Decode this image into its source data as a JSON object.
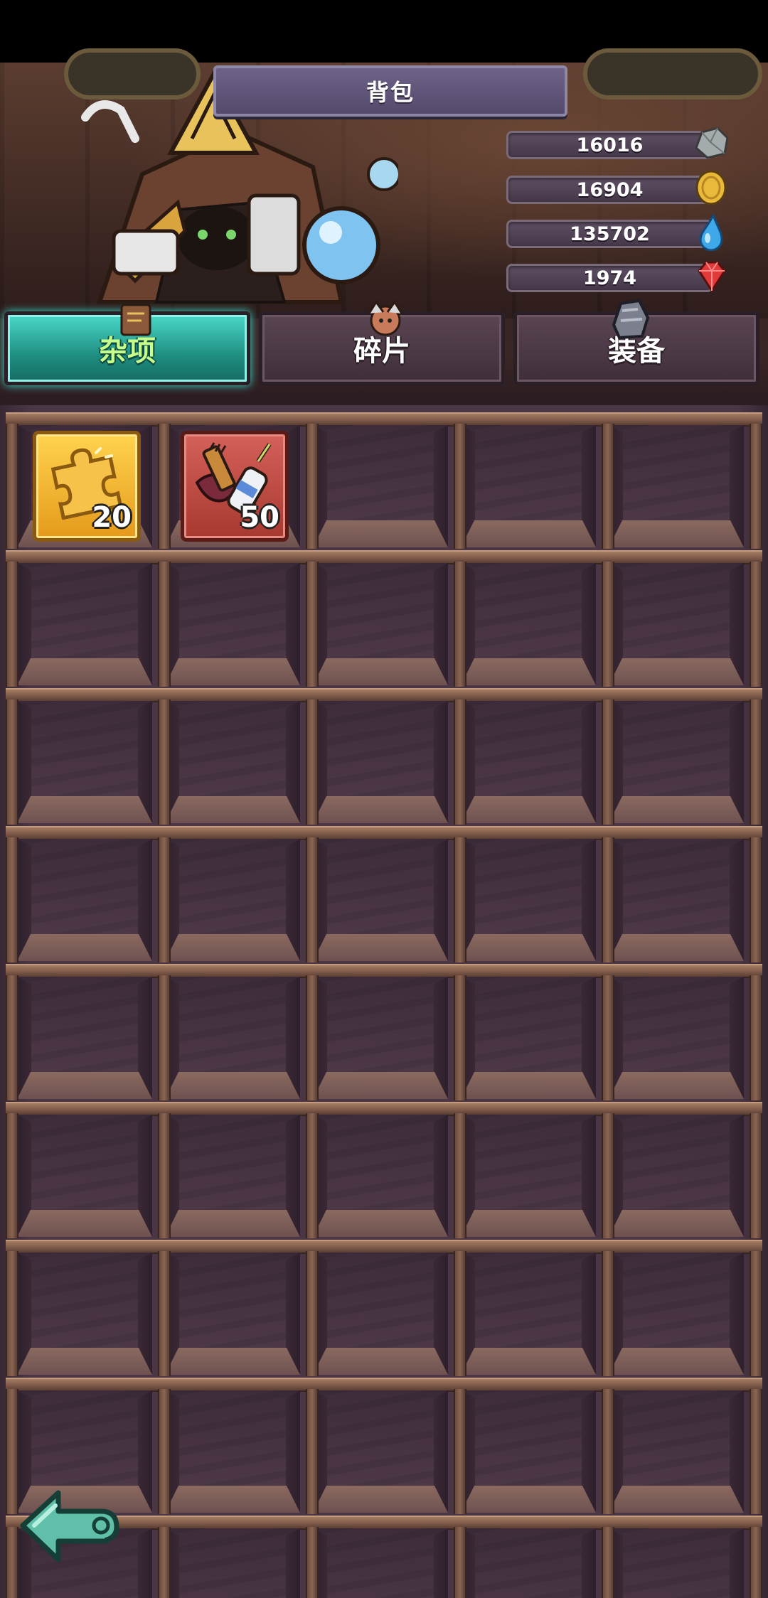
{
  "header": {
    "title": "背包"
  },
  "currencies": [
    {
      "name": "stone",
      "value": "16016",
      "icon": "stone-ore-icon",
      "color": "#9aa3a6"
    },
    {
      "name": "gold",
      "value": "16904",
      "icon": "gold-coin-icon",
      "color": "#e2b338"
    },
    {
      "name": "water",
      "value": "135702",
      "icon": "water-drop-icon",
      "color": "#3ea8e8"
    },
    {
      "name": "gem",
      "value": "1974",
      "icon": "red-gem-icon",
      "color": "#e03a3a"
    }
  ],
  "tabs": [
    {
      "label": "杂项",
      "active": true
    },
    {
      "label": "碎片",
      "active": false
    },
    {
      "label": "装备",
      "active": false
    }
  ],
  "items": [
    {
      "icon": "puzzle-piece-icon",
      "quantity": "20",
      "rarity_color": "#f0b42a"
    },
    {
      "icon": "brush-and-glue-icon",
      "quantity": "50",
      "rarity_color": "#c64b44"
    }
  ],
  "accent_color": "#3ee0d0"
}
